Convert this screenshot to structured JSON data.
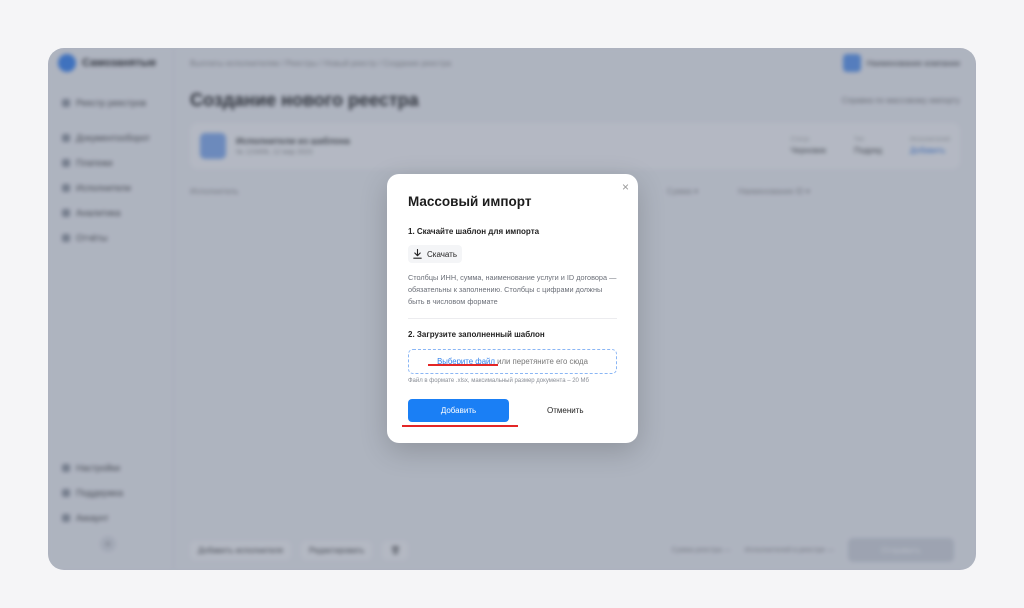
{
  "app": {
    "logo_text": "Самозанятые",
    "sidebar_items": [
      "Реестр реестров",
      "Документооборот",
      "Платежи",
      "Исполнители",
      "Аналитика",
      "Отчёты"
    ],
    "sidebar_bottom_items": [
      "Настройки",
      "Поддержка",
      "Аккаунт"
    ],
    "breadcrumb": "Выплаты исполнителям / Реестры / Новый реестр / Создание реестра",
    "user_name": "Наименование компании",
    "page_title": "Создание нового реестра",
    "page_link": "Справка по массовому импорту",
    "card_title": "Исполнители из шаблона",
    "card_sub": "№ 123456, 12 мар 2023",
    "card_cols": [
      {
        "label": "Статус",
        "value": "Черновик"
      },
      {
        "label": "Тип",
        "value": "Подряд"
      },
      {
        "label": "Исполнителей",
        "value": "Добавить"
      }
    ],
    "list_head_left": "Исполнитель",
    "list_head_mid": "Сумма ▾",
    "list_head_right": "Наименование ID ▾",
    "bottom_buttons": [
      "Добавить исполнителя",
      "Редактировать"
    ],
    "bottom_stats": [
      "Сумма реестра —",
      "Исполнителей в реестре —"
    ],
    "submit_label": "Отправить"
  },
  "modal": {
    "title": "Массовый импорт",
    "close_symbol": "×",
    "step1_title": "1. Скачайте шаблон для импорта",
    "download_label": "Скачать",
    "hint": "Столбцы ИНН, сумма, наименование услуги и ID договора — обязательны к заполнению. Столбцы с цифрами должны быть в числовом формате",
    "step2_title": "2. Загрузите заполненный шаблон",
    "dropzone_link": "Выберите файл",
    "dropzone_text": " или перетяните его сюда",
    "file_note": "Файл в формате .xlsx, максимальный размер документа – 20 Мб",
    "submit_label": "Добавить",
    "cancel_label": "Отменить"
  },
  "colors": {
    "primary": "#1a7ff5",
    "link": "#2f7fea",
    "annotation": "#e32626"
  }
}
